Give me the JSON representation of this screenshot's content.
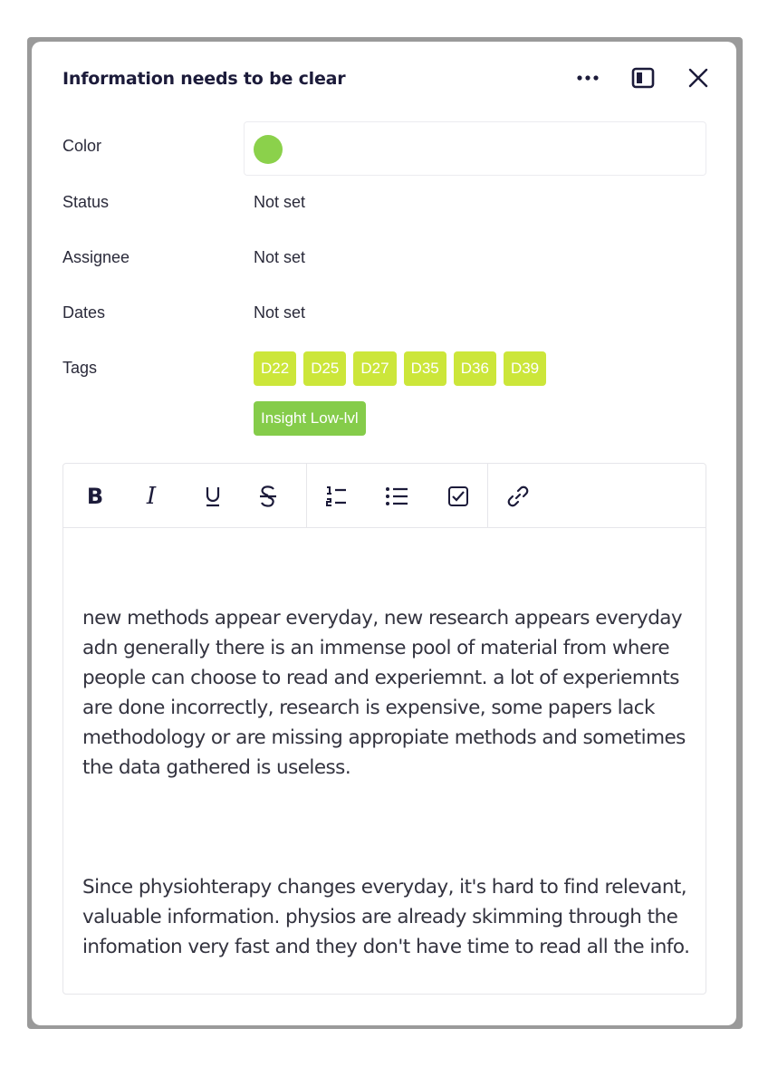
{
  "card": {
    "title": "Information needs to be clear",
    "header_icons": [
      "more-icon",
      "side-panel-icon",
      "close-icon"
    ]
  },
  "fields": {
    "color": {
      "label": "Color",
      "value_color": "#8bd14b"
    },
    "status": {
      "label": "Status",
      "value": "Not set"
    },
    "assignee": {
      "label": "Assignee",
      "value": "Not set"
    },
    "dates": {
      "label": "Dates",
      "value": "Not set"
    },
    "tags": {
      "label": "Tags",
      "items": [
        {
          "label": "D22",
          "color": "#cce63a"
        },
        {
          "label": "D25",
          "color": "#cce63a"
        },
        {
          "label": "D27",
          "color": "#cce63a"
        },
        {
          "label": "D35",
          "color": "#cce63a"
        },
        {
          "label": "D36",
          "color": "#cce63a"
        },
        {
          "label": "D39",
          "color": "#cce63a"
        },
        {
          "label": "Insight Low-lvl",
          "color": "#85cc4a"
        }
      ]
    }
  },
  "editor": {
    "toolbar": {
      "bold": "B",
      "italic": "I",
      "icons": [
        "underline-icon",
        "strikethrough-icon",
        "numbered-list-icon",
        "bullet-list-icon",
        "checklist-icon",
        "link-icon"
      ]
    },
    "paragraphs": [
      "new methods appear everyday, new research appears everyday adn generally there is an immense pool of material from where people can choose to read and experiemnt. a lot of experiemnts are done incorrectly, research is expensive, some papers lack methodology or are missing appropiate methods and sometimes the data gathered is useless.",
      "Since physiohterapy changes everyday, it's hard to find relevant, valuable information. physios are already skimming through the infomation very fast and they don't have time to read all the info."
    ]
  }
}
